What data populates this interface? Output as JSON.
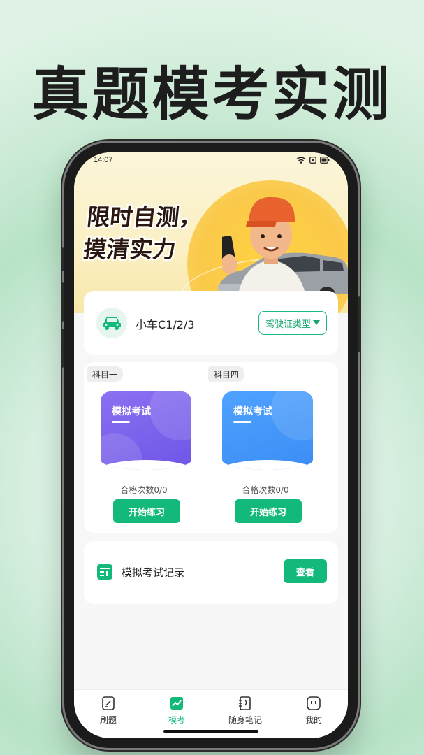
{
  "headline": "真题模考实测",
  "status_bar": {
    "time": "14:07"
  },
  "banner": {
    "slogan_line1": "限时自测，",
    "slogan_line2": "摸清实力"
  },
  "license": {
    "name": "小车C1/2/3",
    "selector_label": "驾驶证类型"
  },
  "subjects": [
    {
      "tag": "科目一",
      "exam_title": "模拟考试",
      "pass_count": "合格次数0/0",
      "button": "开始练习",
      "color": "#7a5ff0"
    },
    {
      "tag": "科目四",
      "exam_title": "模拟考试",
      "pass_count": "合格次数0/0",
      "button": "开始练习",
      "color": "#4496fb"
    }
  ],
  "record": {
    "label": "模拟考试记录",
    "button": "查看"
  },
  "tabbar": {
    "items": [
      {
        "label": "刷题",
        "icon": "edit-icon"
      },
      {
        "label": "模考",
        "icon": "chart-icon",
        "active": true
      },
      {
        "label": "随身笔记",
        "icon": "notebook-icon"
      },
      {
        "label": "我的",
        "icon": "profile-icon"
      }
    ]
  },
  "colors": {
    "accent": "#12b97a",
    "purple_tile": "#7a5ff0",
    "blue_tile": "#4496fb"
  }
}
